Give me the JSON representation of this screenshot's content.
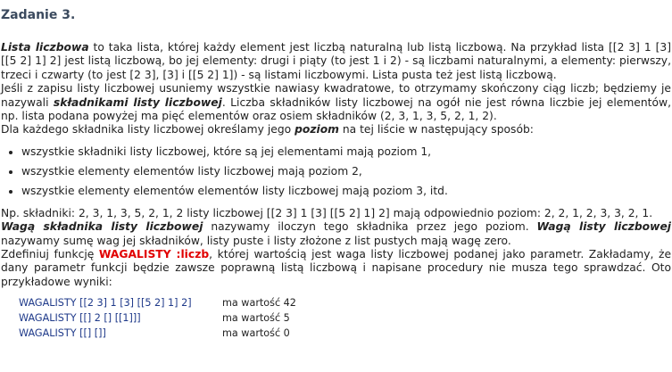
{
  "title": "Zadanie 3.",
  "p1": {
    "term": "Lista liczbowa",
    "text": " to taka lista, której każdy element jest liczbą naturalną lub listą liczbową. Na przykład lista [[2 3] 1 [3] [[5 2] 1] 2] jest listą liczbową, bo jej elementy: drugi i piąty (to jest 1 i 2) - są liczbami naturalnymi, a elementy: pierwszy, trzeci i czwarty (to jest [2 3], [3] i [[5 2] 1]) - są listami liczbowymi. Lista pusta też jest listą liczbową."
  },
  "p2": {
    "text_a": "Jeśli z zapisu listy liczbowej usuniemy wszystkie nawiasy kwadratowe, to otrzymamy skończony ciąg liczb; będziemy je nazywali ",
    "term": "składnikami listy liczbowej",
    "text_b": ". Liczba składników listy liczbowej na ogół nie jest równa liczbie jej elementów, np. lista podana powyżej ma pięć elementów oraz osiem składników (2, 3, 1, 3, 5, 2, 1, 2)."
  },
  "p3": {
    "text_a": "Dla każdego składnika listy liczbowej określamy jego ",
    "term": "poziom",
    "text_b": " na tej liście w następujący sposób:"
  },
  "bullets": [
    "wszystkie składniki listy liczbowej, które są jej elementami mają poziom 1,",
    "wszystkie elementy elementów listy liczbowej mają poziom 2,",
    "wszystkie elementy elementów elementów listy liczbowej mają poziom 3, itd."
  ],
  "p4": "Np. składniki: 2, 3, 1, 3, 5, 2, 1, 2 listy liczbowej [[2 3] 1 [3] [[5 2] 1] 2] mają odpowiednio poziom: 2, 2, 1, 2, 3, 3, 2, 1.",
  "p5": {
    "term1": "Wagą składnika listy liczbowej",
    "text_a": " nazywamy iloczyn tego składnika przez jego poziom. ",
    "term2": "Wagą listy liczbowej",
    "text_b": " nazywamy sumę wag jej składników, listy puste i listy złożone z list pustych mają wagę zero."
  },
  "p6": {
    "text_a": "Zdefiniuj funkcję ",
    "fn": "WAGALISTY :liczb",
    "text_b": ", której wartością jest waga listy liczbowej podanej jako parametr. Zakładamy, że dany parametr funkcji będzie zawsze poprawną listą liczbową i napisane procedury nie musza tego sprawdzać. Oto przykładowe wyniki:"
  },
  "examples": [
    {
      "code": "WAGALISTY [[2 3] 1 [3] [[5 2] 1] 2]",
      "result": "ma wartość 42"
    },
    {
      "code": "WAGALISTY [[] 2 [] [[1]]]",
      "result": "ma wartość 5"
    },
    {
      "code": "WAGALISTY [[] []]",
      "result": "ma wartość 0"
    }
  ]
}
